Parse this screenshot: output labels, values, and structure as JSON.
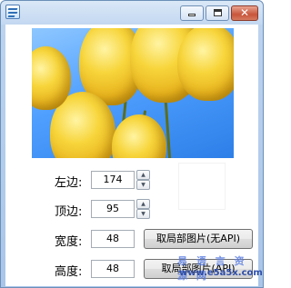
{
  "window": {
    "title": "",
    "controls": {
      "minimize": "minimize",
      "maximize": "maximize",
      "close": "✕"
    }
  },
  "form": {
    "left": {
      "label": "左边:",
      "value": "174"
    },
    "top": {
      "label": "顶边:",
      "value": "95"
    },
    "width": {
      "label": "宽度:",
      "value": "48"
    },
    "height": {
      "label": "高度:",
      "value": "48"
    }
  },
  "buttons": {
    "crop_no_api": "取局部图片(无API)",
    "crop_api": "取局部图片(API)"
  },
  "watermark": {
    "line1": "易 语 言 资 源 网",
    "line2": "www.e5a5x.com"
  },
  "icons": {
    "app": "app-icon",
    "spin_up": "spin-up-icon",
    "spin_down": "spin-down-icon"
  }
}
